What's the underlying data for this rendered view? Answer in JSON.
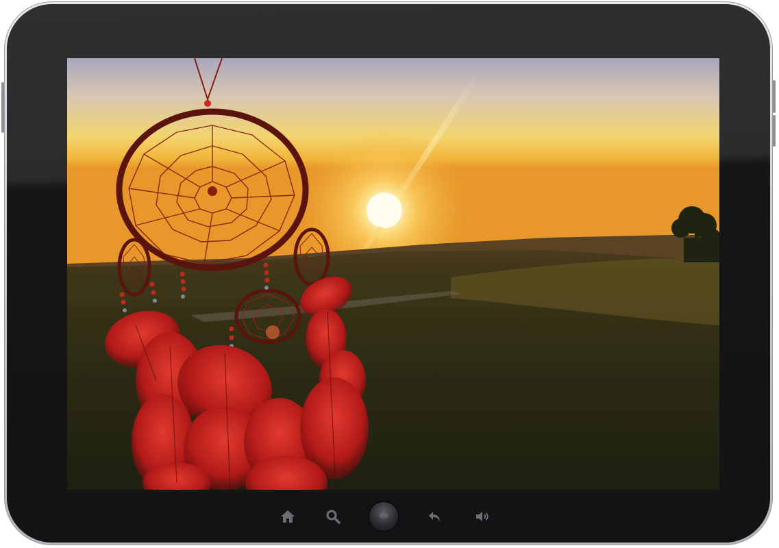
{
  "device": {
    "type": "tablet",
    "frame_color": "#1d1e20",
    "bezel_edge_color": "#c9cbce"
  },
  "screen": {
    "wallpaper": {
      "subject": "dreamcatcher-sunset",
      "sky_top_color": "#b7b9cc",
      "sky_mid_color": "#f3c75d",
      "horizon_color": "#f0a12b",
      "ground_color": "#2a2a12",
      "accent_color": "#c0201c"
    }
  },
  "navbar": {
    "icons": [
      {
        "name": "home-icon",
        "color": "#6c6e72"
      },
      {
        "name": "search-icon",
        "color": "#6c6e72"
      },
      {
        "name": "back-icon",
        "color": "#6c6e72"
      },
      {
        "name": "volume-icon",
        "color": "#6c6e72"
      }
    ]
  }
}
